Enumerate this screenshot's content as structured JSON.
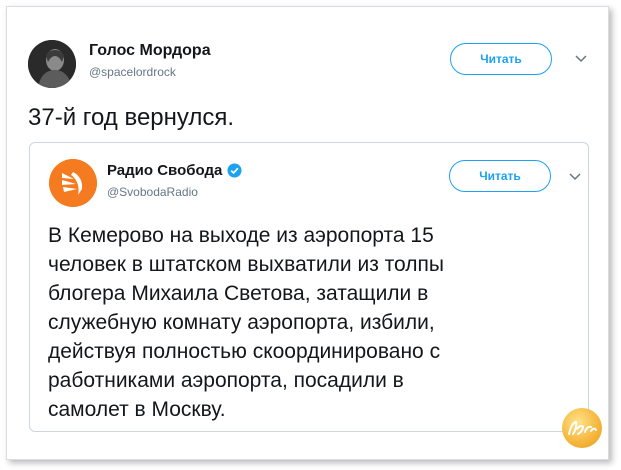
{
  "tweet": {
    "author_name": "Голос Мордора",
    "author_handle": "@spacelordrock",
    "follow_label": "Читать",
    "text": "37-й год вернулся."
  },
  "quoted": {
    "author_name": "Радио Свобода",
    "author_handle": "@SvobodaRadio",
    "follow_label": "Читать",
    "verified": true,
    "lines": [
      "В Кемерово на выходе из аэропорта 15",
      "человек в штатском выхватили из толпы",
      "блогера Михаила Светова, затащили в",
      "служебную комнату аэропорта, избили,",
      "действуя полностью скоординировано с",
      "работниками аэропорта, посадили в",
      "самолет в Москву."
    ]
  },
  "colors": {
    "accent": "#1da1f2",
    "text": "#14171a",
    "secondary": "#657786",
    "radio_logo": "#f47b20"
  },
  "icons": {
    "more": "chevron-down-icon",
    "verified": "verified-badge-icon"
  }
}
